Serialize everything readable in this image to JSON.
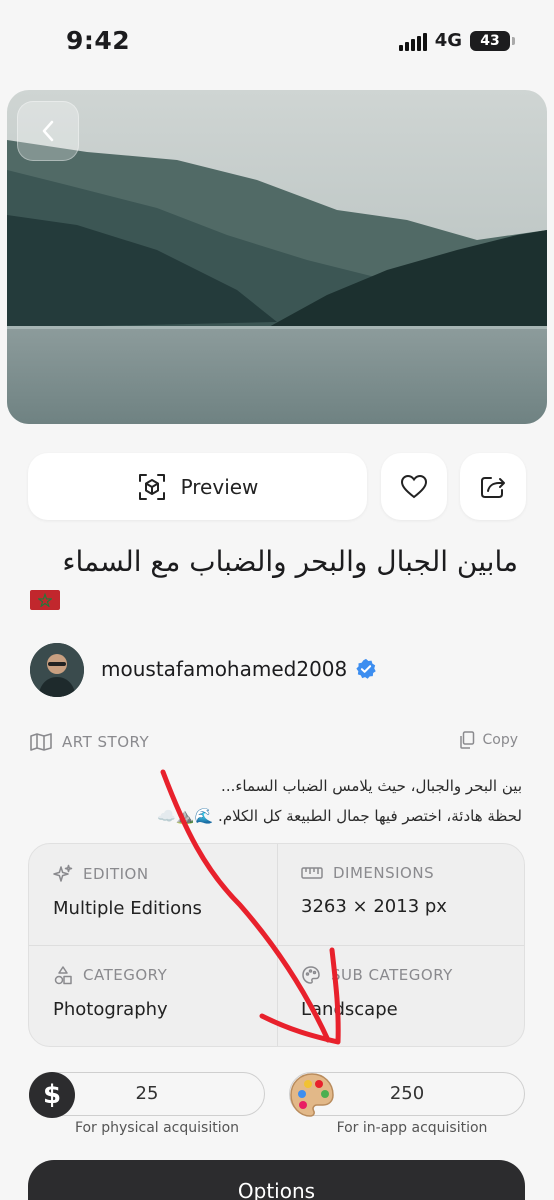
{
  "status_bar": {
    "time": "9:42",
    "network": "4G",
    "battery": "43"
  },
  "actions": {
    "preview_label": "Preview"
  },
  "artwork": {
    "title": "مابين الجبال والبحر والضباب مع السماء",
    "author": "moustafamohamed2008"
  },
  "story": {
    "heading": "ART STORY",
    "copy_label": "Copy",
    "lines": [
      "بين البحر والجبال، حيث يلامس الضباب السماء...",
      "لحظة هادئة، اختصر فيها جمال الطبيعة كل الكلام. 🌊⛰️☁️"
    ]
  },
  "details": {
    "edition": {
      "label": "EDITION",
      "value": "Multiple Editions"
    },
    "dimensions": {
      "label": "DIMENSIONS",
      "value": "3263 × 2013 px"
    },
    "category": {
      "label": "CATEGORY",
      "value": "Photography"
    },
    "sub_category": {
      "label": "SUB CATEGORY",
      "value": "Landscape"
    }
  },
  "pricing": {
    "physical": {
      "value": "25",
      "caption": "For physical acquisition"
    },
    "in_app": {
      "value": "250",
      "caption": "For in-app acquisition"
    }
  },
  "cta": {
    "options_label": "Options"
  },
  "colors": {
    "accent_dark": "#2c2c2e",
    "verified_blue": "#3d8ef0",
    "annotation_red": "#e8212c"
  }
}
